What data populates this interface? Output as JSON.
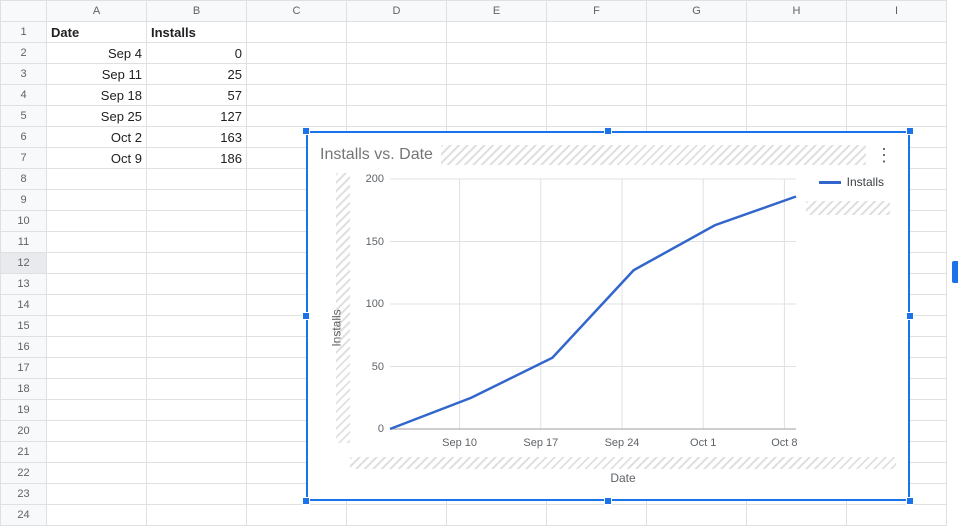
{
  "columns": [
    "A",
    "B",
    "C",
    "D",
    "E",
    "F",
    "G",
    "H",
    "I"
  ],
  "row_count": 24,
  "selected_row": 12,
  "headers": {
    "A": "Date",
    "B": "Installs"
  },
  "data_rows": [
    {
      "A": "Sep 4",
      "B": "0"
    },
    {
      "A": "Sep 11",
      "B": "25"
    },
    {
      "A": "Sep 18",
      "B": "57"
    },
    {
      "A": "Sep 25",
      "B": "127"
    },
    {
      "A": "Oct 2",
      "B": "163"
    },
    {
      "A": "Oct 9",
      "B": "186"
    }
  ],
  "chart": {
    "title": "Installs vs. Date",
    "xlabel": "Date",
    "ylabel": "Installs",
    "legend": "Installs",
    "yticks": [
      "0",
      "50",
      "100",
      "150",
      "200"
    ],
    "xticks": [
      "Sep 10",
      "Sep 17",
      "Sep 24",
      "Oct 1",
      "Oct 8"
    ]
  },
  "chart_data": {
    "type": "line",
    "title": "Installs vs. Date",
    "xlabel": "Date",
    "ylabel": "Installs",
    "ylim": [
      0,
      200
    ],
    "series": [
      {
        "name": "Installs",
        "color": "#3366cc",
        "x": [
          "Sep 4",
          "Sep 11",
          "Sep 18",
          "Sep 25",
          "Oct 2",
          "Oct 9"
        ],
        "y": [
          0,
          25,
          57,
          127,
          163,
          186
        ]
      }
    ],
    "xticks": [
      "Sep 10",
      "Sep 17",
      "Sep 24",
      "Oct 1",
      "Oct 8"
    ]
  }
}
